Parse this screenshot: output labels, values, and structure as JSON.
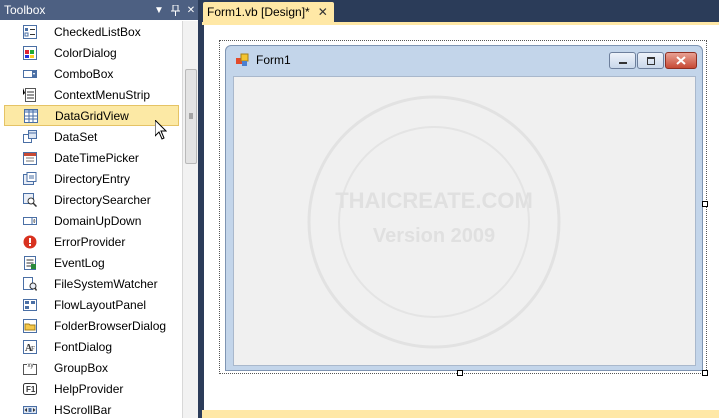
{
  "toolbox": {
    "title": "Toolbox",
    "header_buttons": [
      "▼",
      "ᛘ",
      "✕"
    ],
    "items": [
      {
        "label": "CheckedListBox",
        "icon": "checkedlistbox-icon"
      },
      {
        "label": "ColorDialog",
        "icon": "colordialog-icon"
      },
      {
        "label": "ComboBox",
        "icon": "combobox-icon"
      },
      {
        "label": "ContextMenuStrip",
        "icon": "contextmenustrip-icon"
      },
      {
        "label": "DataGridView",
        "icon": "datagridview-icon",
        "selected": true
      },
      {
        "label": "DataSet",
        "icon": "dataset-icon"
      },
      {
        "label": "DateTimePicker",
        "icon": "datetimepicker-icon"
      },
      {
        "label": "DirectoryEntry",
        "icon": "directoryentry-icon"
      },
      {
        "label": "DirectorySearcher",
        "icon": "directorysearcher-icon"
      },
      {
        "label": "DomainUpDown",
        "icon": "domainupdown-icon"
      },
      {
        "label": "ErrorProvider",
        "icon": "errorprovider-icon"
      },
      {
        "label": "EventLog",
        "icon": "eventlog-icon"
      },
      {
        "label": "FileSystemWatcher",
        "icon": "filesystemwatcher-icon"
      },
      {
        "label": "FlowLayoutPanel",
        "icon": "flowlayoutpanel-icon"
      },
      {
        "label": "FolderBrowserDialog",
        "icon": "folderbrowserdialog-icon"
      },
      {
        "label": "FontDialog",
        "icon": "fontdialog-icon"
      },
      {
        "label": "GroupBox",
        "icon": "groupbox-icon"
      },
      {
        "label": "HelpProvider",
        "icon": "helpprovider-icon"
      },
      {
        "label": "HScrollBar",
        "icon": "hscrollbar-icon"
      }
    ]
  },
  "document": {
    "tab_label": "Form1.vb [Design]*",
    "tab_close": "✕"
  },
  "form": {
    "title": "Form1"
  },
  "colors": {
    "chrome_dark": "#2b3c59",
    "tab_active": "#ffe8a6",
    "selection": "#fce9a5",
    "form_frame": "#c3d5ea"
  }
}
